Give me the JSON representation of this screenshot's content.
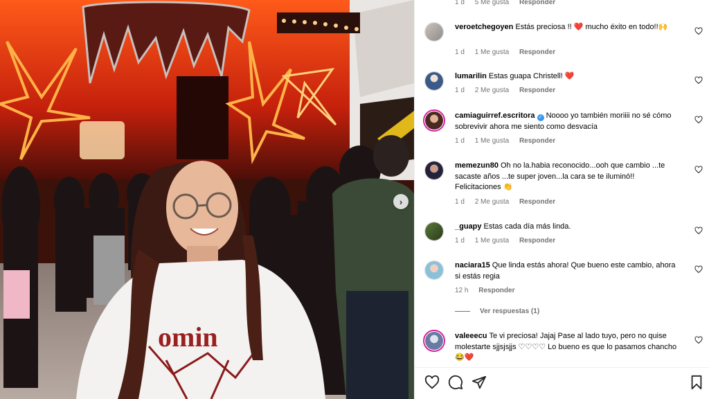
{
  "post": {
    "next_button_glyph": "›",
    "shirt_text": "omin"
  },
  "comments_panel": {
    "top_partial": {
      "time": "1 d",
      "likes": "5 Me gusta",
      "reply": "Responder"
    },
    "comments": [
      {
        "user": "veroetchegoyen",
        "text": "Estás preciosa !! ❤️ mucho éxito en todo!!🙌",
        "time": "1 d",
        "likes": "1 Me gusta",
        "reply": "Responder"
      },
      {
        "user": "lumarilin",
        "text": "Estas guapa Christell! ❤️",
        "time": "1 d",
        "likes": "2 Me gusta",
        "reply": "Responder"
      },
      {
        "user": "camiaguirref.escritora",
        "text": "Noooo yo también moriiii no sé cómo sobrevivir ahora me siento como desvacía",
        "time": "1 d",
        "likes": "1 Me gusta",
        "reply": "Responder"
      },
      {
        "user": "memezun80",
        "text": "Oh no la.habia reconocido...ooh que cambio ...te sacaste años ...te super joven...la cara se te iluminó!! Felicitaciones 👏",
        "time": "1 d",
        "likes": "2 Me gusta",
        "reply": "Responder"
      },
      {
        "user": "_guapy",
        "text": "Estas cada día más linda.",
        "time": "1 d",
        "likes": "1 Me gusta",
        "reply": "Responder"
      },
      {
        "user": "naciara15",
        "text": "Que linda estás ahora! Que bueno este cambio, ahora si estás regia",
        "time": "12 h",
        "likes": "",
        "reply": "Responder"
      },
      {
        "user": "valeeecu",
        "text": "Te vi preciosa! Jajaj Pase al lado tuyo, pero no quise molestarte sjjsjsjjs ♡♡♡♡ Lo bueno es que lo pasamos chancho 😂❤️",
        "time": "",
        "likes": "",
        "reply": ""
      }
    ],
    "view_replies": "Ver respuestas (1)"
  },
  "icons": {
    "like": "heart-icon",
    "comment": "comment-icon",
    "share": "share-icon",
    "save": "bookmark-icon"
  },
  "colors": {
    "story_ring": "#d6249f",
    "verified": "#3897f0",
    "heart": "#ed4956",
    "meta_text": "#737373"
  }
}
